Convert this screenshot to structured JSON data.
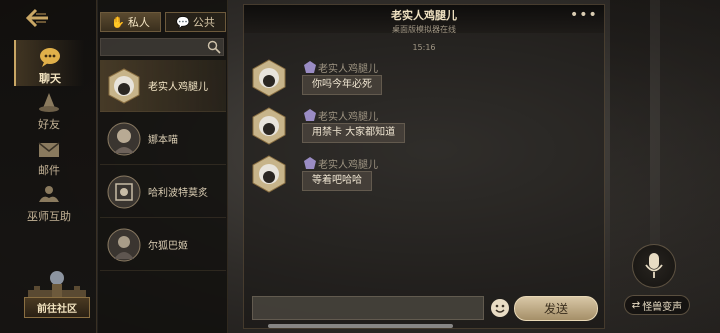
{
  "nav": {
    "items": [
      {
        "label": "聊天",
        "icon": "chat-bubble-icon",
        "active": true
      },
      {
        "label": "好友",
        "icon": "wizard-hat-icon",
        "active": false
      },
      {
        "label": "邮件",
        "icon": "envelope-icon",
        "active": false
      },
      {
        "label": "巫师互助",
        "icon": "helping-hands-icon",
        "active": false
      }
    ],
    "community_label": "前往社区"
  },
  "tabs": [
    {
      "label": "私人",
      "icon": "hand-icon",
      "active": true
    },
    {
      "label": "公共",
      "icon": "chat-bubbles-icon",
      "active": false
    }
  ],
  "search": {
    "placeholder": ""
  },
  "contacts": [
    {
      "name": "老实人鸡腿儿",
      "active": true
    },
    {
      "name": "娜本喵",
      "active": false
    },
    {
      "name": "哈利波特莫炙",
      "active": false
    },
    {
      "name": "尔狐巴姬",
      "active": false
    }
  ],
  "chat": {
    "title": "老实人鸡腿儿",
    "subtitle": "桌面版模拟器在线",
    "timestamp": "15:16",
    "messages": [
      {
        "sender": "老实人鸡腿儿",
        "text": "你吗今年必死"
      },
      {
        "sender": "老实人鸡腿儿",
        "text": "用禁卡 大家都知道"
      },
      {
        "sender": "老实人鸡腿儿",
        "text": "等着吧哈哈"
      }
    ],
    "input_placeholder": "",
    "send_label": "发送"
  },
  "voice": {
    "label": "怪兽变声"
  },
  "colors": {
    "accent": "#c9a765",
    "panel": "#18160e",
    "bubble": "#46403a",
    "send": "#d8c7a6"
  }
}
